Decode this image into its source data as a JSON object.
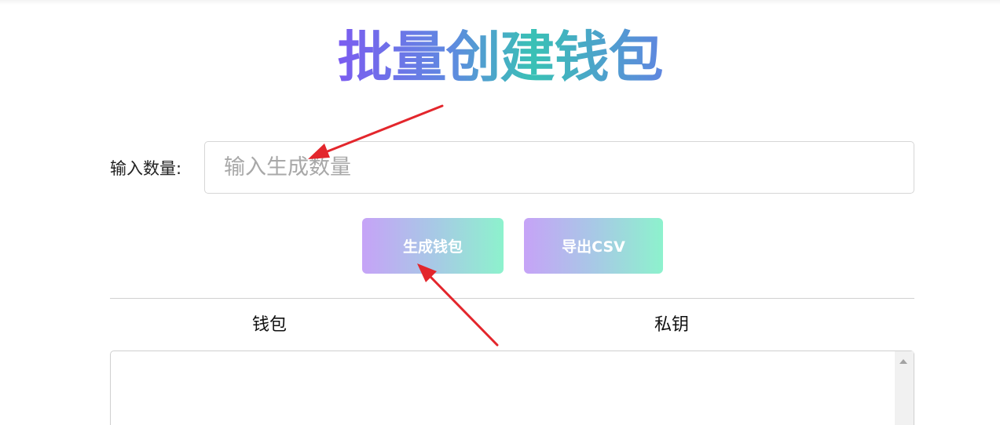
{
  "title": "批量创建钱包",
  "quantity": {
    "label": "输入数量:",
    "placeholder": "输入生成数量",
    "value": ""
  },
  "buttons": {
    "generate": "生成钱包",
    "export": "导出CSV"
  },
  "table": {
    "headers": [
      "钱包",
      "私钥"
    ]
  },
  "colors": {
    "title_gradient": [
      "#7b5cf0",
      "#39c1b5"
    ],
    "button_gradient": [
      "#c6a3f7",
      "#8df2cd"
    ],
    "annotation_arrow": "#e3262c"
  }
}
